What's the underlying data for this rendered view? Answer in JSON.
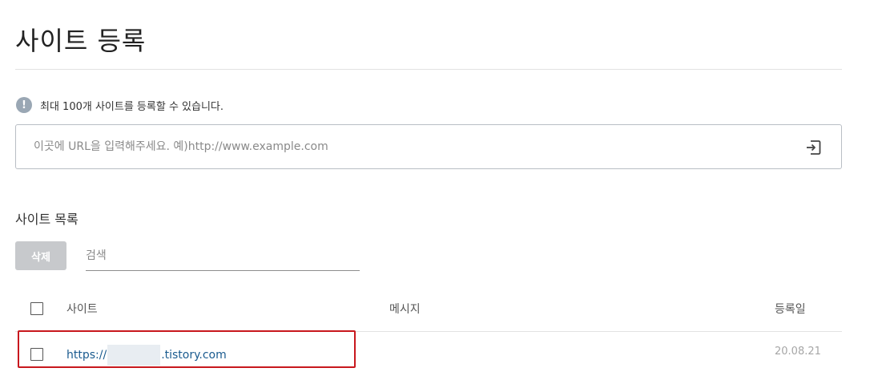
{
  "page": {
    "title": "사이트 등록"
  },
  "notice": {
    "icon": "exclamation-circle-icon",
    "icon_glyph": "!",
    "text": "최대 100개 사이트를 등록할 수 있습니다."
  },
  "url_input": {
    "placeholder": "이곳에 URL을 입력해주세요. 예)http://www.example.com",
    "value": "",
    "submit_icon": "enter-arrow-icon"
  },
  "site_list": {
    "title": "사이트 목록",
    "delete_label": "삭제",
    "search_placeholder": "검색",
    "columns": {
      "site": "사이트",
      "message": "메시지",
      "date": "등록일"
    },
    "rows": [
      {
        "url_prefix": "https://",
        "url_suffix": ".tistory.com",
        "message": "",
        "date": "20.08.21",
        "checked": false
      }
    ]
  },
  "colors": {
    "link": "#1a5b8f",
    "highlight_border": "#c8181e",
    "disabled_button": "#c7c9cc",
    "notice_icon": "#9aa7b4"
  }
}
